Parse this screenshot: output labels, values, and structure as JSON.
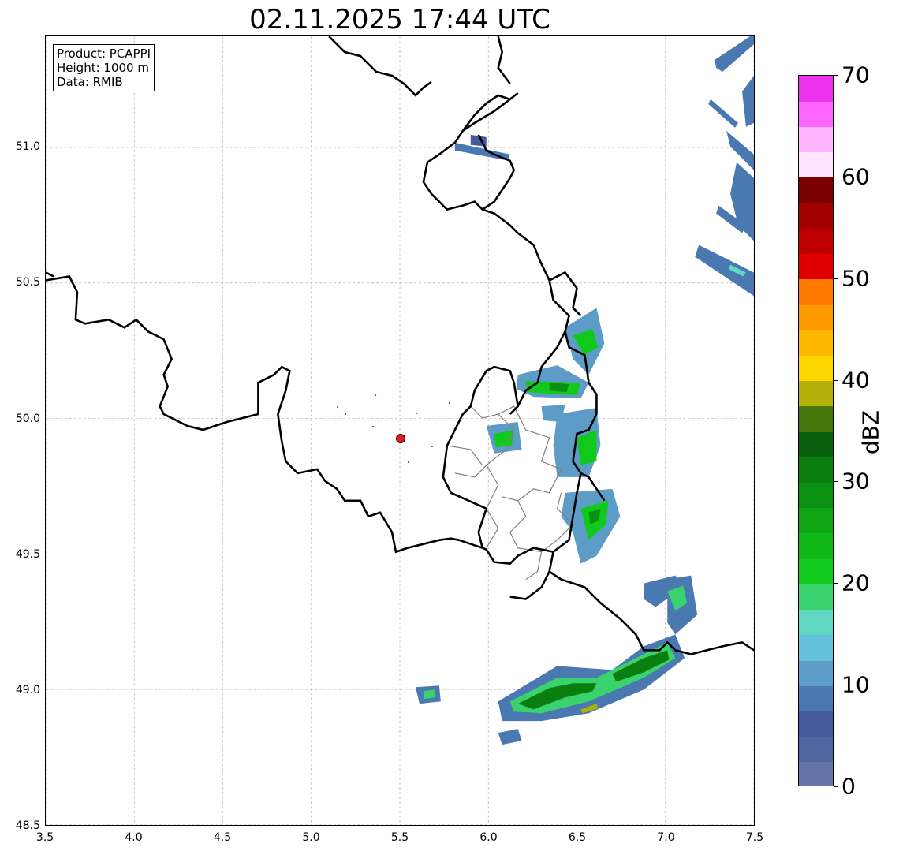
{
  "title": "02.11.2025 17:44 UTC",
  "info": {
    "product": "Product: PCAPPI",
    "height": "Height: 1000 m",
    "data": "Data: RMIB"
  },
  "axes": {
    "x_ticks": [
      "3.5",
      "4.0",
      "4.5",
      "5.0",
      "5.5",
      "6.0",
      "6.5",
      "7.0",
      "7.5"
    ],
    "y_ticks": [
      "51.0",
      "50.5",
      "50.0",
      "49.5",
      "49.0",
      "48.5"
    ],
    "xlim": [
      3.5,
      7.5
    ],
    "ylim": [
      48.5,
      51.41
    ],
    "grid": true
  },
  "radar_site": {
    "lon": 5.505,
    "lat": 49.915,
    "color": "#e31a1c"
  },
  "colorbar": {
    "label": "dBZ",
    "ticks": [
      "0",
      "10",
      "20",
      "30",
      "40",
      "50",
      "60",
      "70"
    ],
    "range": [
      0,
      70
    ],
    "step": 2.5,
    "colors": [
      "#6573a8",
      "#50669e",
      "#435b9c",
      "#4a78b1",
      "#5d9cc6",
      "#66c2dc",
      "#5fd7c3",
      "#3ad26c",
      "#10c91b",
      "#10b81a",
      "#0fa615",
      "#0c9012",
      "#0b7e10",
      "#075e0c",
      "#45770a",
      "#b0b006",
      "#ffd600",
      "#ffb800",
      "#ff9900",
      "#ff7800",
      "#e00000",
      "#c00000",
      "#a00000",
      "#7a0000",
      "#ffe3ff",
      "#ffb4ff",
      "#ff66ff",
      "#ee33ee"
    ]
  },
  "colors": {
    "border_country": "#000000",
    "border_province": "#808080",
    "grid": "#b0b0b0"
  }
}
